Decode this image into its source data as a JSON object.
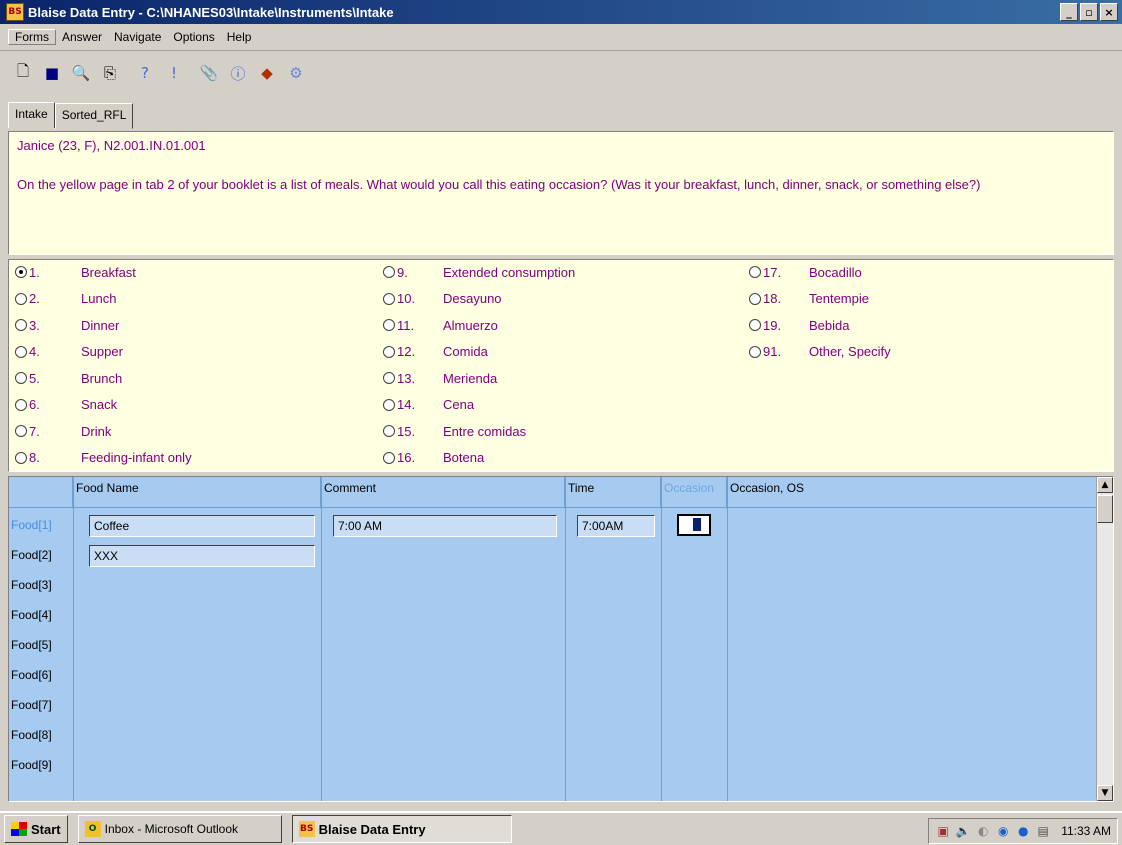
{
  "window": {
    "title": "Blaise Data Entry - C:\\NHANES03\\Intake\\Instruments\\Intake",
    "icon": "blaise-app-icon",
    "buttons": {
      "minimize": "_",
      "maximize": "▫",
      "close": "×"
    }
  },
  "menu": {
    "items": [
      {
        "label": "Forms"
      },
      {
        "label": "Answer"
      },
      {
        "label": "Navigate"
      },
      {
        "label": "Options"
      },
      {
        "label": "Help"
      }
    ]
  },
  "toolbar": {
    "icons": [
      "new-icon",
      "save-icon",
      "find-icon",
      "copy-icon",
      "help-icon",
      "info-icon",
      "clip-icon",
      "info-circle-icon",
      "remark-icon",
      "watch-icon"
    ]
  },
  "tabs": [
    {
      "label": "Intake"
    },
    {
      "label": "Sorted_RFL"
    }
  ],
  "question": {
    "header": "Janice (23, F),    N2.001.IN.01.001",
    "text": "On the yellow page in tab 2 of your booklet is a list of meals.  What would you call this eating occasion?  (Was it your breakfast, lunch, dinner, snack, or something else?)"
  },
  "answers": [
    {
      "num": "1.",
      "label": "Breakfast",
      "selected": true
    },
    {
      "num": "2.",
      "label": "Lunch"
    },
    {
      "num": "3.",
      "label": "Dinner"
    },
    {
      "num": "4.",
      "label": "Supper"
    },
    {
      "num": "5.",
      "label": "Brunch"
    },
    {
      "num": "6.",
      "label": "Snack"
    },
    {
      "num": "7.",
      "label": "Drink"
    },
    {
      "num": "8.",
      "label": "Feeding-infant only"
    },
    {
      "num": "9.",
      "label": "Extended consumption"
    },
    {
      "num": "10.",
      "label": "Desayuno"
    },
    {
      "num": "11.",
      "label": "Almuerzo"
    },
    {
      "num": "12.",
      "label": "Comida"
    },
    {
      "num": "13.",
      "label": "Merienda"
    },
    {
      "num": "14.",
      "label": "Cena"
    },
    {
      "num": "15.",
      "label": "Entre comidas"
    },
    {
      "num": "16.",
      "label": "Botena"
    },
    {
      "num": "17.",
      "label": "Bocadillo"
    },
    {
      "num": "18.",
      "label": "Tentempie"
    },
    {
      "num": "19.",
      "label": "Bebida"
    },
    {
      "num": "91.",
      "label": "Other, Specify"
    }
  ],
  "grid": {
    "headers": {
      "food_name": "Food Name",
      "comment": "Comment",
      "time": "Time",
      "occasion": "Occasion",
      "occasion_os": "Occasion, OS"
    },
    "rows": [
      "Food[1]",
      "Food[2]",
      "Food[3]",
      "Food[4]",
      "Food[5]",
      "Food[6]",
      "Food[7]",
      "Food[8]",
      "Food[9]"
    ],
    "cells": {
      "food1_name": "Coffee",
      "food1_comment": "7:00 AM",
      "food1_time": "7:00AM",
      "food2_name": "XXX"
    }
  },
  "taskbar": {
    "start": "Start",
    "tasks": [
      {
        "label": "Inbox - Microsoft Outlook"
      },
      {
        "label": "Blaise Data Entry"
      }
    ],
    "clock": "11:33 AM"
  }
}
